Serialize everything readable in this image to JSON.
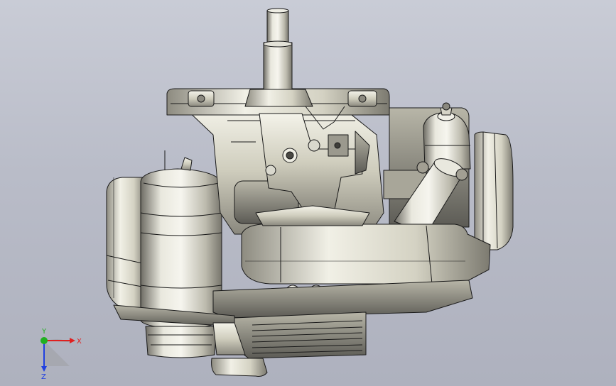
{
  "viewport": {
    "background_top": "#c9ccd6",
    "background_bottom": "#aeb1be",
    "model_description_icon": "engine-3d-model"
  },
  "colors": {
    "metal_light": "#f2f1e6",
    "metal_mid": "#c8c6b6",
    "metal_dark": "#6f6e66",
    "edge": "#1a1a1a",
    "axis_x": "#e02020",
    "axis_y": "#20b020",
    "axis_z": "#2040e0"
  },
  "triad": {
    "x_label": "X",
    "y_label": "Y",
    "z_label": "Z"
  }
}
